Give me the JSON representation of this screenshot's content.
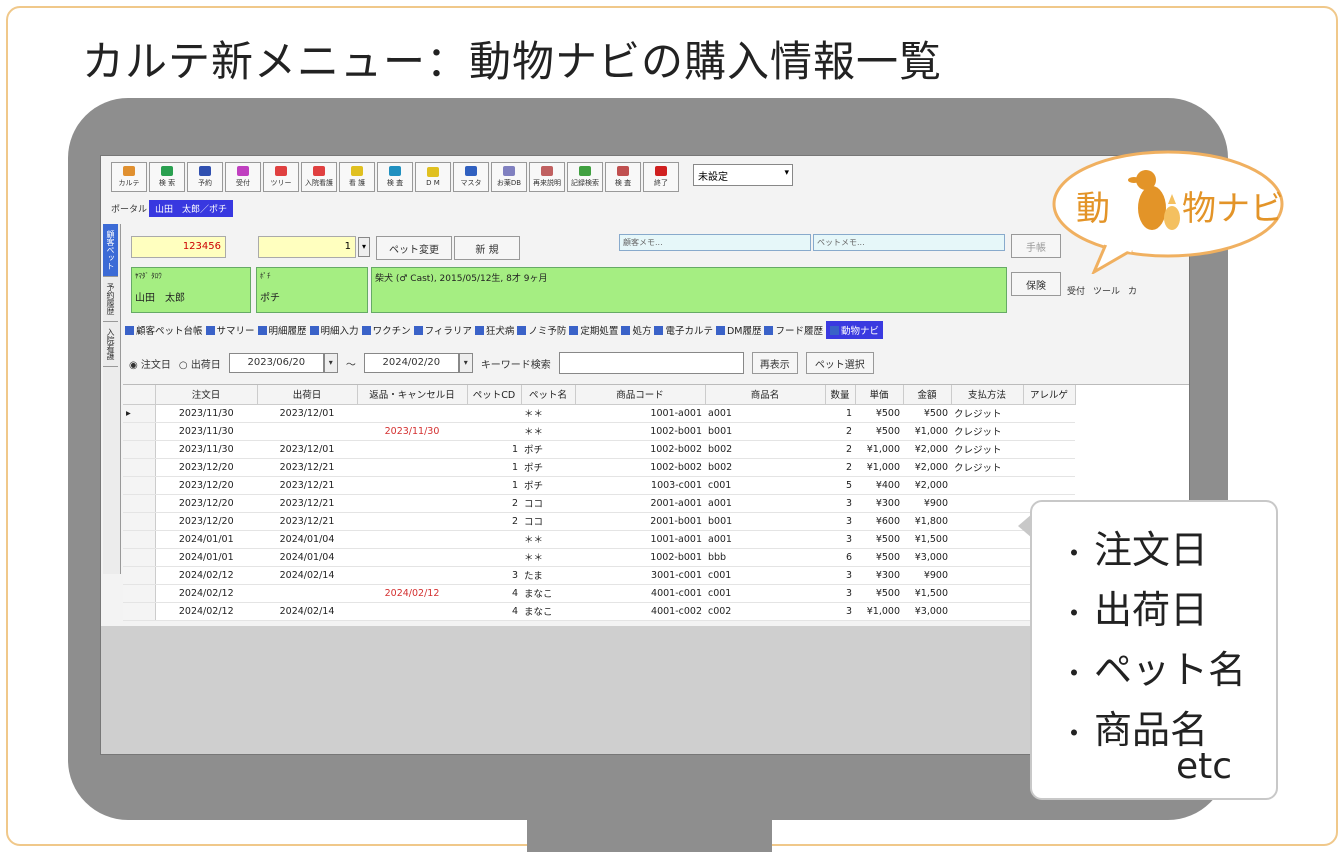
{
  "page_title": "カルテ新メニュー：動物ナビの購入情報一覧",
  "toolbar": {
    "buttons": [
      "カルテ",
      "検 索",
      "予約",
      "受付",
      "ツリー",
      "入院看護",
      "看 護",
      "検 査",
      "D M",
      "マスタ",
      "お薬DB",
      "再来説明",
      "記録検索",
      "検 査",
      "終了"
    ],
    "icon_colors": [
      "#e09030",
      "#2aa050",
      "#3050b0",
      "#c040c0",
      "#e04040",
      "#e04040",
      "#e0c020",
      "#2090c0",
      "#e0c020",
      "#3060c0",
      "#8080c0",
      "#c06060",
      "#40a040",
      "#c05050",
      "#d02020"
    ],
    "select_value": "未設定"
  },
  "portal_label": "ポータル",
  "portal_tab": "山田　太郎／ポチ",
  "side_tabs": [
    "顧客ペット",
    "予約履歴",
    "入院看護"
  ],
  "patient": {
    "id": "123456",
    "pet_no": "1",
    "pet_change": "ペット変更",
    "new_label": "新 規",
    "customer_memo": "顧客メモ...",
    "pet_memo": "ペットメモ...",
    "hand_label": "手帳",
    "owner_kana": "ﾔﾏﾀﾞ ﾀﾛｳ",
    "owner_name": "山田　太郎",
    "pet_kana": "ﾎﾟﾁ",
    "pet_name": "ポチ",
    "pet_info": "柴犬 (♂ Cast), 2015/05/12生, 8才 9ヶ月",
    "insurance": "保険",
    "right_menu": [
      "受付",
      "ツール",
      "カ"
    ]
  },
  "tabs": [
    "顧客ペット台帳",
    "サマリー",
    "明細履歴",
    "明細入力",
    "ワクチン",
    "フィラリア",
    "狂犬病",
    "ノミ予防",
    "定期処置",
    "処方",
    "電子カルテ",
    "DM履歴",
    "フード履歴",
    "動物ナビ"
  ],
  "filter": {
    "radio_order": "注文日",
    "radio_ship": "出荷日",
    "from": "2023/06/20",
    "tilde": "～",
    "to": "2024/02/20",
    "keyword_label": "キーワード検索",
    "redisplay": "再表示",
    "pet_select": "ペット選択"
  },
  "grid": {
    "headers": [
      "注文日",
      "出荷日",
      "返品・キャンセル日",
      "ペットCD",
      "ペット名",
      "商品コード",
      "商品名",
      "数量",
      "単価",
      "金額",
      "支払方法",
      "アレルゲ"
    ],
    "rows": [
      [
        "2023/11/30",
        "2023/12/01",
        "",
        "",
        "＊＊",
        "1001-a001",
        "a001",
        "1",
        "¥500",
        "¥500",
        "クレジット"
      ],
      [
        "2023/11/30",
        "",
        "2023/11/30",
        "",
        "＊＊",
        "1002-b001",
        "b001",
        "2",
        "¥500",
        "¥1,000",
        "クレジット"
      ],
      [
        "2023/11/30",
        "2023/12/01",
        "",
        "1",
        "ポチ",
        "1002-b002",
        "b002",
        "2",
        "¥1,000",
        "¥2,000",
        "クレジット"
      ],
      [
        "2023/12/20",
        "2023/12/21",
        "",
        "1",
        "ポチ",
        "1002-b002",
        "b002",
        "2",
        "¥1,000",
        "¥2,000",
        "クレジット"
      ],
      [
        "2023/12/20",
        "2023/12/21",
        "",
        "1",
        "ポチ",
        "1003-c001",
        "c001",
        "5",
        "¥400",
        "¥2,000",
        ""
      ],
      [
        "2023/12/20",
        "2023/12/21",
        "",
        "2",
        "ココ",
        "2001-a001",
        "a001",
        "3",
        "¥300",
        "¥900",
        ""
      ],
      [
        "2023/12/20",
        "2023/12/21",
        "",
        "2",
        "ココ",
        "2001-b001",
        "b001",
        "3",
        "¥600",
        "¥1,800",
        ""
      ],
      [
        "2024/01/01",
        "2024/01/04",
        "",
        "",
        "＊＊",
        "1001-a001",
        "a001",
        "3",
        "¥500",
        "¥1,500",
        ""
      ],
      [
        "2024/01/01",
        "2024/01/04",
        "",
        "",
        "＊＊",
        "1002-b001",
        "bbb",
        "6",
        "¥500",
        "¥3,000",
        ""
      ],
      [
        "2024/02/12",
        "2024/02/14",
        "",
        "3",
        "たま",
        "3001-c001",
        "c001",
        "3",
        "¥300",
        "¥900",
        ""
      ],
      [
        "2024/02/12",
        "",
        "2024/02/12",
        "4",
        "まなこ",
        "4001-c001",
        "c001",
        "3",
        "¥500",
        "¥1,500",
        ""
      ],
      [
        "2024/02/12",
        "2024/02/14",
        "",
        "4",
        "まなこ",
        "4001-c002",
        "c002",
        "3",
        "¥1,000",
        "¥3,000",
        ""
      ]
    ]
  },
  "navi_bubble": {
    "text_left": "動",
    "text_right": "物ナビ"
  },
  "callout": {
    "items": [
      "注文日",
      "出荷日",
      "ペット名",
      "商品名"
    ],
    "etc": "etc"
  }
}
